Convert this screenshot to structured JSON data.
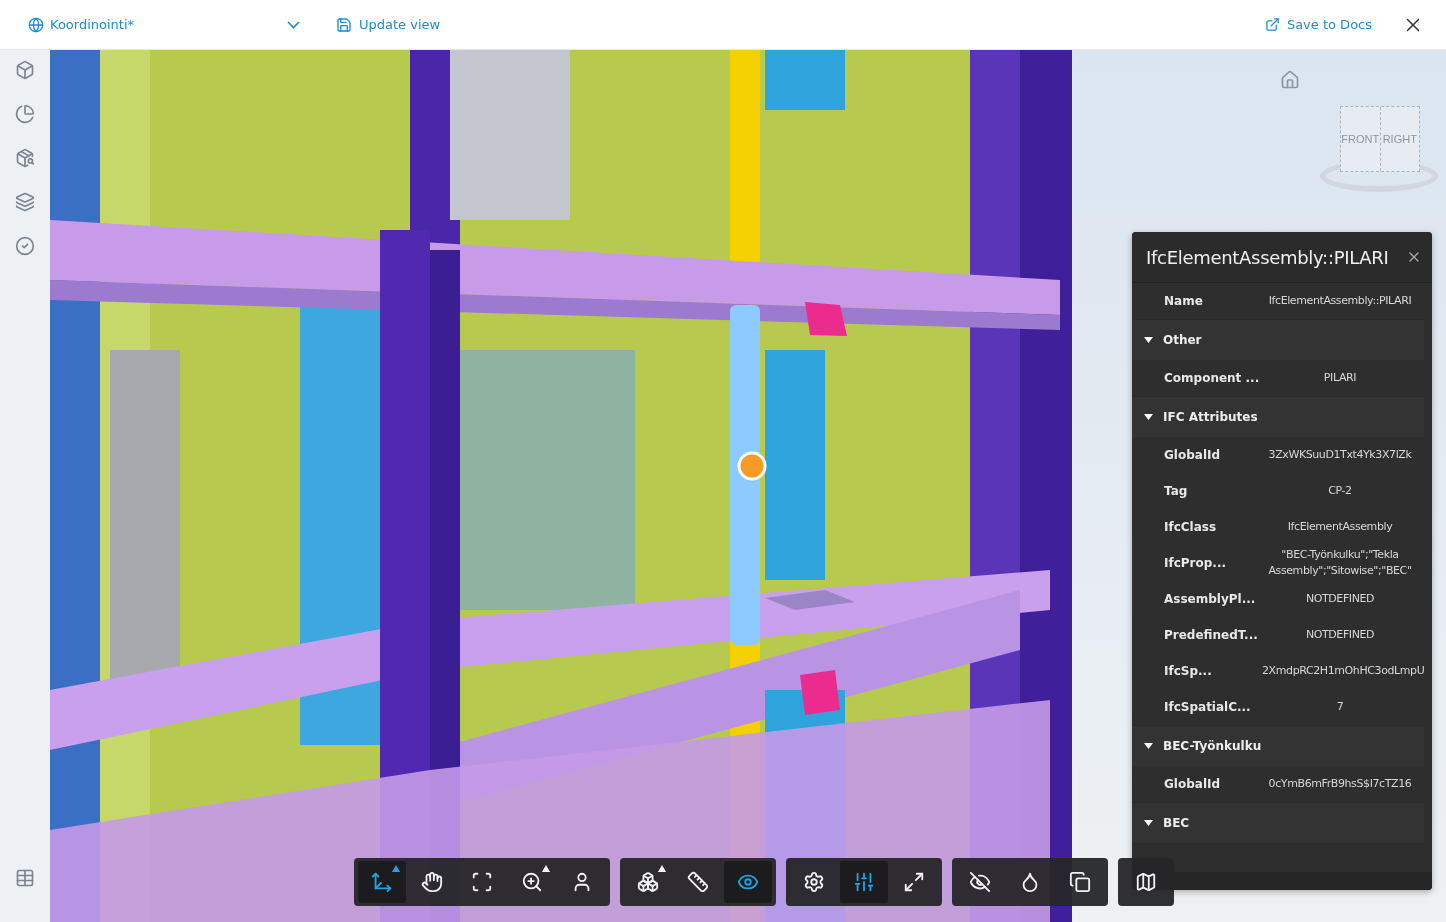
{
  "header": {
    "view_name": "Koordinointi*",
    "update_label": "Update view",
    "save_label": "Save to Docs"
  },
  "viewcube": {
    "faces": [
      "FRONT",
      "RIGHT"
    ]
  },
  "properties": {
    "title": "IfcElementAssembly::PILARI",
    "rows": [
      {
        "kind": "property",
        "label": "Name",
        "value": "IfcElementAssembly::PILARI"
      },
      {
        "kind": "section",
        "label": "Other",
        "expanded": true
      },
      {
        "kind": "property",
        "label": "Component ...",
        "value": "PILARI"
      },
      {
        "kind": "section",
        "label": "IFC Attributes",
        "expanded": true
      },
      {
        "kind": "property",
        "label": "GlobalId",
        "value": "3ZxWKSuuD1Txt4Yk3X7lZk"
      },
      {
        "kind": "property",
        "label": "Tag",
        "value": "CP-2"
      },
      {
        "kind": "property",
        "label": "IfcClass",
        "value": "IfcElementAssembly"
      },
      {
        "kind": "property",
        "label": "IfcProp...",
        "value": "\"BEC-Työnkulku\";\"Tekla Assembly\";\"Sitowise\";\"BEC\""
      },
      {
        "kind": "property",
        "label": "AssemblyPl...",
        "value": "NOTDEFINED"
      },
      {
        "kind": "property",
        "label": "PredefinedT...",
        "value": "NOTDEFINED"
      },
      {
        "kind": "property",
        "label": "IfcSp...",
        "value": "2XmdpRC2H1mOhHC3odLmpU"
      },
      {
        "kind": "property",
        "label": "IfcSpatialC...",
        "value": "7"
      },
      {
        "kind": "section",
        "label": "BEC-Työnkulku",
        "expanded": true
      },
      {
        "kind": "property",
        "label": "GlobalId",
        "value": "0cYmB6mFrB9hsS$I7cTZ16"
      },
      {
        "kind": "section",
        "label": "BEC",
        "expanded": true
      }
    ]
  },
  "toolbar": [
    {
      "tools": [
        {
          "selected": true,
          "has_menu": true
        },
        {
          "selected": false,
          "has_menu": false
        },
        {
          "selected": false,
          "has_menu": false
        },
        {
          "selected": false,
          "has_menu": true
        },
        {
          "selected": false,
          "has_menu": false
        }
      ]
    },
    {
      "tools": [
        {
          "selected": false,
          "has_menu": true
        },
        {
          "selected": false,
          "has_menu": false
        },
        {
          "selected": true,
          "has_menu": false
        }
      ]
    },
    {
      "tools": [
        {
          "selected": false,
          "has_menu": false
        },
        {
          "selected": true,
          "has_menu": false
        },
        {
          "selected": false,
          "has_menu": false
        }
      ]
    },
    {
      "tools": [
        {
          "selected": false,
          "has_menu": false
        },
        {
          "selected": false,
          "has_menu": false
        },
        {
          "selected": false,
          "has_menu": false
        }
      ]
    },
    {
      "tools": [
        {
          "selected": false,
          "has_menu": false
        }
      ]
    }
  ]
}
